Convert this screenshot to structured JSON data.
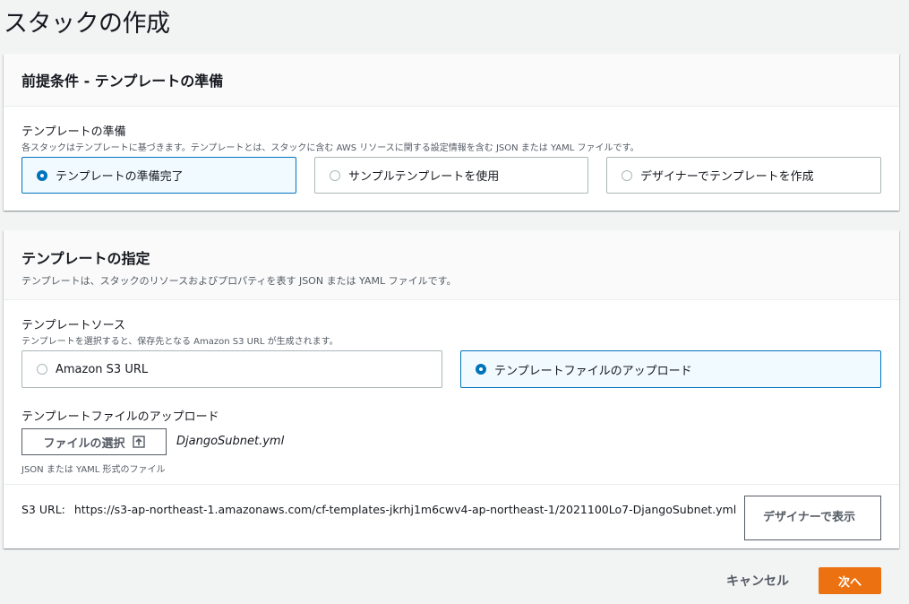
{
  "page": {
    "title": "スタックの作成"
  },
  "prereq": {
    "title": "前提条件 - テンプレートの準備",
    "field_label": "テンプレートの準備",
    "field_desc": "各スタックはテンプレートに基づきます。テンプレートとは、スタックに含む AWS リソースに関する設定情報を含む JSON または YAML ファイルです。",
    "options": [
      {
        "label": "テンプレートの準備完了",
        "selected": true
      },
      {
        "label": "サンプルテンプレートを使用",
        "selected": false
      },
      {
        "label": "デザイナーでテンプレートを作成",
        "selected": false
      }
    ]
  },
  "spec": {
    "title": "テンプレートの指定",
    "desc": "テンプレートは、スタックのリソースおよびプロパティを表す JSON または YAML ファイルです。",
    "source_label": "テンプレートソース",
    "source_desc": "テンプレートを選択すると、保存先となる Amazon S3 URL が生成されます。",
    "options": [
      {
        "label": "Amazon S3 URL",
        "selected": false
      },
      {
        "label": "テンプレートファイルのアップロード",
        "selected": true
      }
    ],
    "upload_label": "テンプレートファイルのアップロード",
    "choose_file_label": "ファイルの選択",
    "file_name": "DjangoSubnet.yml",
    "file_hint": "JSON または YAML 形式のファイル",
    "s3_url_label": "S3 URL:",
    "s3_url_value": "https://s3-ap-northeast-1.amazonaws.com/cf-templates-jkrhj1m6cwv4-ap-northeast-1/2021100Lo7-DjangoSubnet.yml",
    "designer_button_label": "デザイナーで表示"
  },
  "footer": {
    "cancel_label": "キャンセル",
    "next_label": "次へ"
  },
  "colors": {
    "accent": "#0073bb",
    "primary_button": "#ec7211"
  },
  "icons": {
    "upload": "upload-icon"
  }
}
